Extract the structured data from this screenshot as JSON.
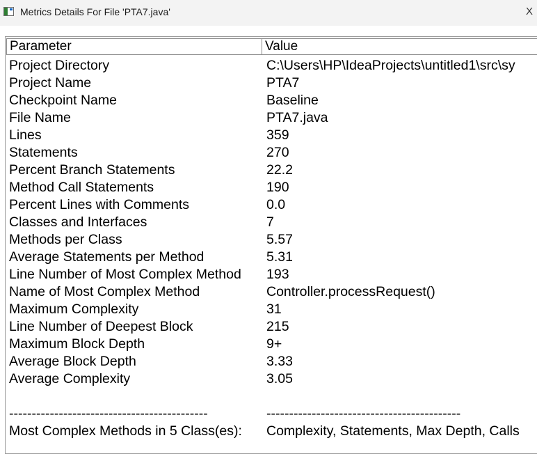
{
  "window": {
    "title": "Metrics Details For File 'PTA7.java'",
    "close_glyph": "X"
  },
  "table": {
    "headers": [
      "Parameter",
      "Value"
    ],
    "rows": [
      {
        "param": "Project Directory",
        "value": "C:\\Users\\HP\\IdeaProjects\\untitled1\\src\\sy"
      },
      {
        "param": "Project Name",
        "value": "PTA7"
      },
      {
        "param": "Checkpoint Name",
        "value": "Baseline"
      },
      {
        "param": "File Name",
        "value": "PTA7.java"
      },
      {
        "param": "Lines",
        "value": "359"
      },
      {
        "param": "Statements",
        "value": "270"
      },
      {
        "param": "Percent Branch Statements",
        "value": "22.2"
      },
      {
        "param": "Method Call Statements",
        "value": "190"
      },
      {
        "param": "Percent Lines with Comments",
        "value": "0.0"
      },
      {
        "param": "Classes and Interfaces",
        "value": "7"
      },
      {
        "param": "Methods per Class",
        "value": "5.57"
      },
      {
        "param": "Average Statements per Method",
        "value": "5.31"
      },
      {
        "param": "Line Number of Most Complex Method",
        "value": "193"
      },
      {
        "param": "Name of Most Complex Method",
        "value": "Controller.processRequest()"
      },
      {
        "param": "Maximum Complexity",
        "value": "31"
      },
      {
        "param": "Line Number of Deepest Block",
        "value": "215"
      },
      {
        "param": "Maximum Block Depth",
        "value": "9+"
      },
      {
        "param": "Average Block Depth",
        "value": "3.33"
      },
      {
        "param": "Average Complexity",
        "value": "3.05"
      },
      {
        "param": "",
        "value": ""
      },
      {
        "param": "--------------------------------------------",
        "value": "-------------------------------------------"
      },
      {
        "param": "Most Complex Methods in 5 Class(es):",
        "value": "Complexity, Statements, Max Depth, Calls"
      }
    ]
  }
}
